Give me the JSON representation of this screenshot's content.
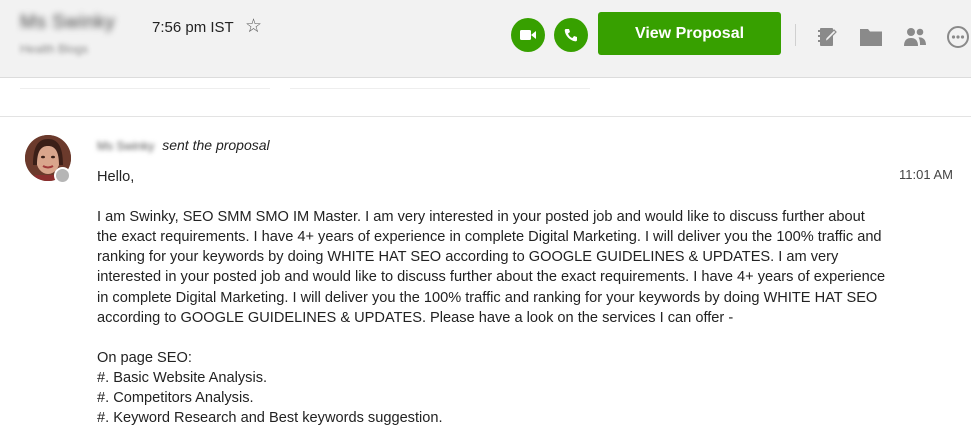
{
  "header": {
    "contact_name": "Ms Swinky",
    "contact_time": "7:56 pm IST",
    "contact_subtitle": "Health Blogs",
    "view_proposal_label": "View Proposal"
  },
  "icons": {
    "favorite": "star-outline-icon",
    "video_call": "video-camera-icon",
    "voice_call": "phone-icon",
    "notes": "notes-icon",
    "files": "folder-icon",
    "people": "people-icon",
    "more": "ellipsis-icon"
  },
  "colors": {
    "accent_green": "#37a000",
    "header_bg": "#f2f2f2"
  },
  "message": {
    "sender_name": "Ms Swinky",
    "action": "sent the proposal",
    "time": "11:01 AM",
    "greeting": "Hello,",
    "paragraph": "I am Swinky, SEO SMM SMO IM Master. I am very interested in your posted job and would like to discuss further about the exact requirements. I have 4+ years of experience in complete Digital Marketing. I will deliver you the 100% traffic and ranking for your keywords by doing WHITE HAT SEO according to GOOGLE GUIDELINES & UPDATES. I am very interested in your posted job and would like to discuss further about the exact requirements. I have 4+ years of experience in complete Digital Marketing. I will deliver you the 100% traffic and ranking for your keywords by doing WHITE HAT SEO according to GOOGLE GUIDELINES & UPDATES. Please have a look on the services I can offer -",
    "list_title": "On page SEO:",
    "list_items": [
      "#. Basic Website Analysis.",
      "#. Competitors Analysis.",
      "#. Keyword Research and Best keywords suggestion."
    ]
  }
}
